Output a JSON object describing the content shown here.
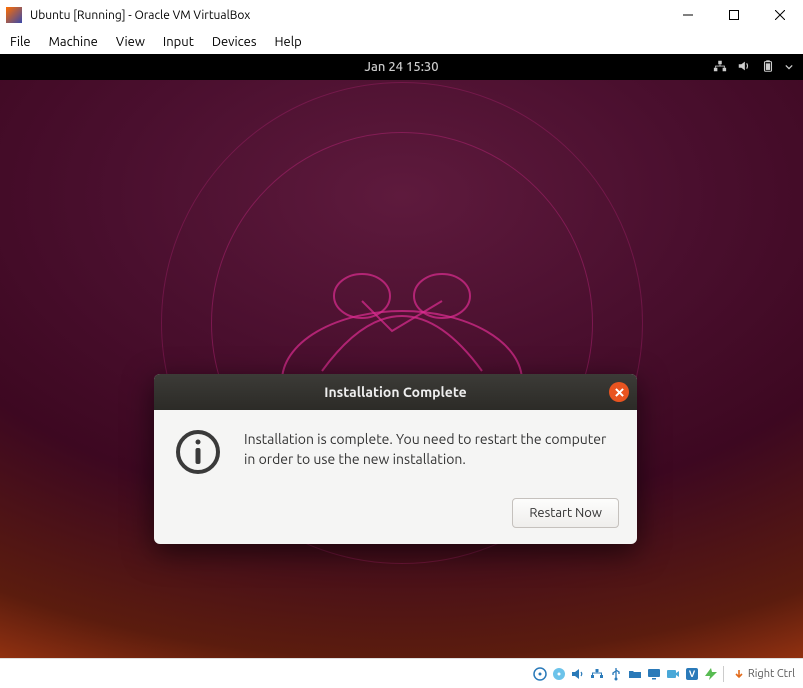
{
  "window": {
    "title": "Ubuntu [Running] - Oracle VM VirtualBox"
  },
  "vbox_menu": {
    "items": [
      "File",
      "Machine",
      "View",
      "Input",
      "Devices",
      "Help"
    ]
  },
  "gnome": {
    "clock": "Jan 24  15:30"
  },
  "dialog": {
    "title": "Installation Complete",
    "message": "Installation is complete. You need to restart the computer in order to use the new installation.",
    "button": "Restart Now"
  },
  "statusbar": {
    "host_key": "Right Ctrl"
  }
}
